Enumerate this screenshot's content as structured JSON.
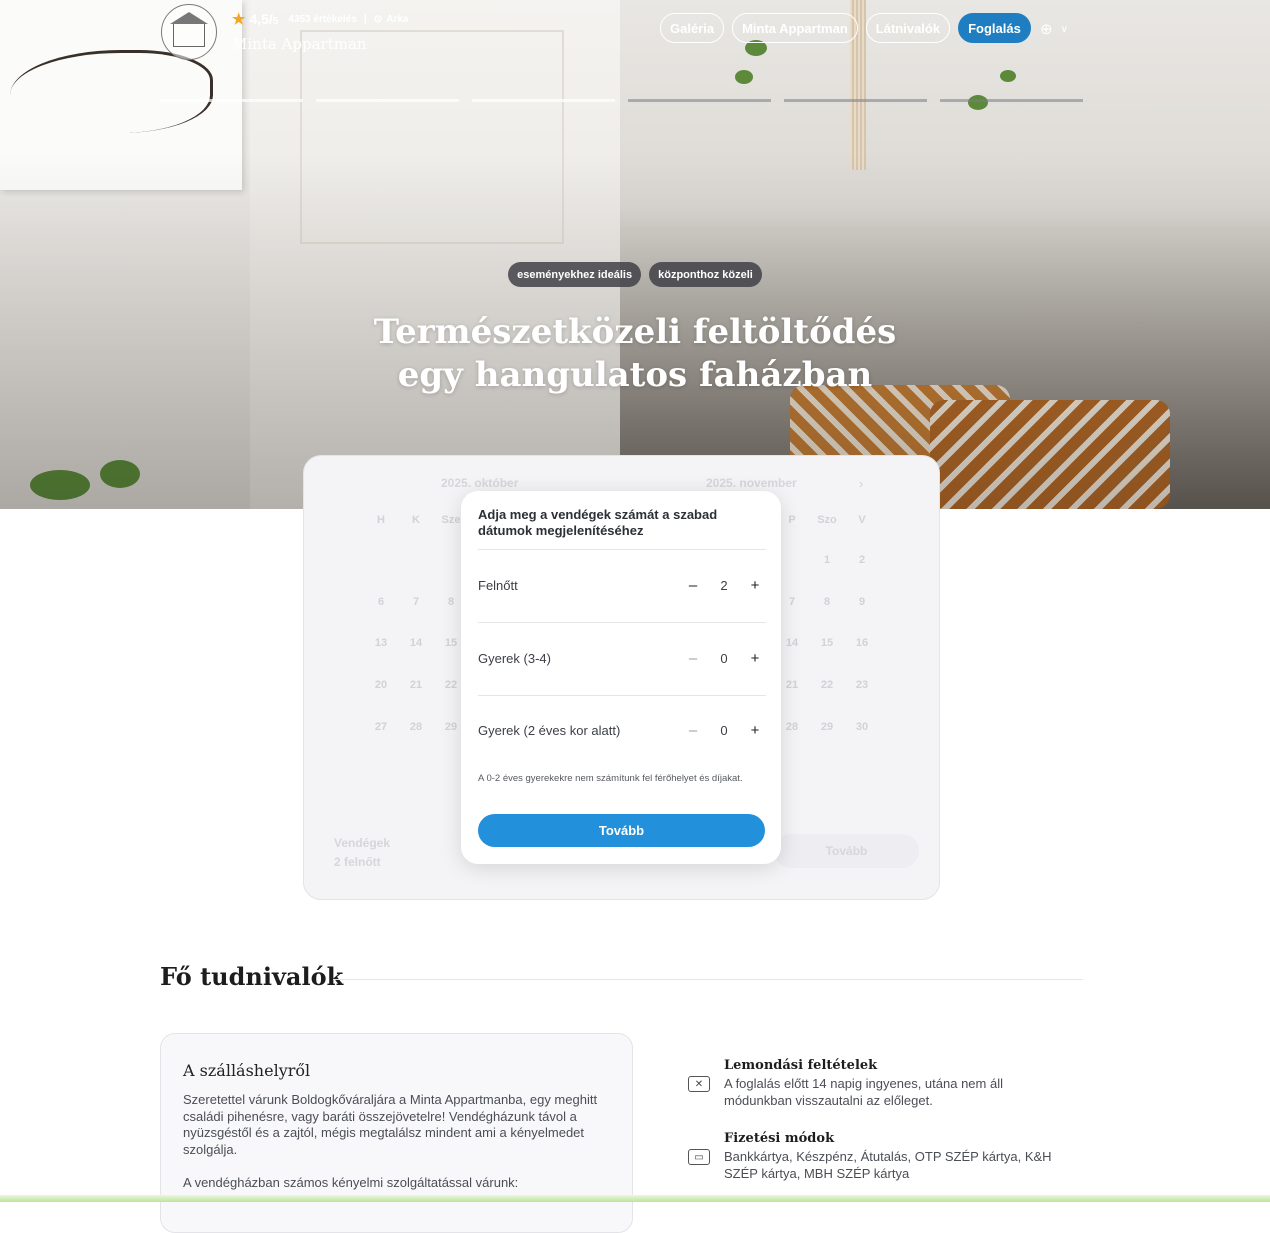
{
  "header": {
    "rating_score": "4,5/",
    "rating_max": "5",
    "reviews": "4353 értékelés",
    "separator": "|",
    "location": "Arka",
    "brand": "Minta Appartman",
    "nav": [
      "Galéria",
      "Minta Appartman",
      "Látnivalók",
      "Foglalás"
    ]
  },
  "hero": {
    "tags": [
      "eseményekhez ideális",
      "központhoz közeli"
    ],
    "title_line1": "Természetközeli feltöltődés",
    "title_line2": "egy hangulatos faházban"
  },
  "calendar": {
    "month_left": "2025. október",
    "month_right": "2025. november",
    "weekdays_left": [
      "H",
      "K",
      "Sze"
    ],
    "weekdays_right": [
      "P",
      "Szo",
      "V"
    ],
    "rows_left": [
      [
        "6",
        "7",
        "8"
      ],
      [
        "13",
        "14",
        "15"
      ],
      [
        "20",
        "21",
        "22"
      ],
      [
        "27",
        "28",
        "29"
      ]
    ],
    "rows_right": [
      [
        "",
        "1",
        "2"
      ],
      [
        "7",
        "8",
        "9"
      ],
      [
        "14",
        "15",
        "16"
      ],
      [
        "21",
        "22",
        "23"
      ],
      [
        "28",
        "29",
        "30"
      ]
    ],
    "guests_label": "Vendégek",
    "guests_value": "2 felnőtt",
    "next_label": "Tovább"
  },
  "guest_modal": {
    "title": "Adja meg a vendégek számát a szabad dátumok megjelenítéséhez",
    "rows": [
      {
        "label": "Felnőtt",
        "value": "2",
        "minus": "–",
        "plus": "+"
      },
      {
        "label": "Gyerek (3-4)",
        "value": "0",
        "minus": "–",
        "plus": "+"
      },
      {
        "label": "Gyerek (2 éves kor alatt)",
        "value": "0",
        "minus": "–",
        "plus": "+"
      }
    ],
    "note": "A 0-2 éves gyerekekre nem számítunk fel férőhelyet és díjakat.",
    "button": "Tovább"
  },
  "section": {
    "title": "Fő tudnivalók",
    "card_title": "A szálláshelyről",
    "card_text1": "Szeretettel várunk Boldogkőváraljára a Minta Appartmanba, egy meghitt családi pihenésre, vagy baráti összejövetelre! Vendégházunk távol a nyüzsgéstől és a zajtól, mégis megtalálsz mindent ami a kényelmedet szolgálja.",
    "card_text2": "A vendégházban számos kényelmi szolgáltatással várunk:",
    "features": [
      {
        "icon": "cancel-icon",
        "title": "Lemondási feltételek",
        "text": "A foglalás előtt 14 napig ingyenes, utána nem áll módunkban visszautalni az előleget."
      },
      {
        "icon": "payment-icon",
        "title": "Fizetési módok",
        "text": "Bankkártya, Készpénz, Átutalás, OTP SZÉP kártya, K&H SZÉP kártya, MBH SZÉP kártya"
      }
    ]
  },
  "colors": {
    "accent": "#1f7ec1",
    "button": "#2390dc",
    "star": "#f5a623"
  }
}
